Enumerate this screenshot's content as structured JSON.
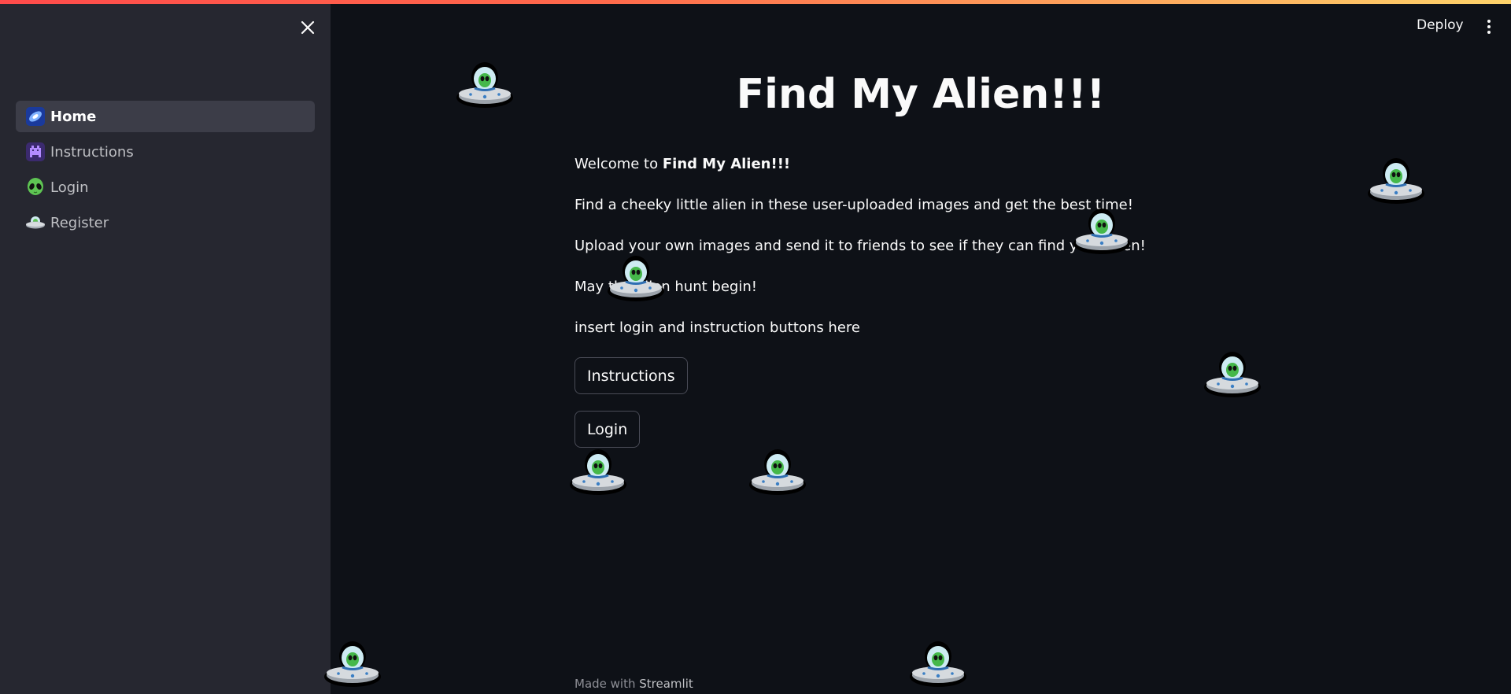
{
  "sidebar": {
    "close_label": "×",
    "items": [
      {
        "label": "Home",
        "icon": "galaxy-icon",
        "active": true
      },
      {
        "label": "Instructions",
        "icon": "space-invader-icon",
        "active": false
      },
      {
        "label": "Login",
        "icon": "alien-icon",
        "active": false
      },
      {
        "label": "Register",
        "icon": "ufo-icon",
        "active": false
      }
    ]
  },
  "header": {
    "deploy_label": "Deploy"
  },
  "main": {
    "title": "Find My Alien!!!",
    "welcome_prefix": "Welcome to ",
    "welcome_bold": "Find My Alien!!!",
    "line1": "Find a cheeky little alien in these user-uploaded images and get the best time!",
    "line2": "Upload your own images and send it to friends to see if they can find your alien!",
    "line3": "May the alien hunt begin!",
    "line4": "insert login and instruction buttons here",
    "instructions_button": "Instructions",
    "login_button": "Login"
  },
  "footer": {
    "prefix": "Made with ",
    "brand": "Streamlit"
  },
  "colors": {
    "background": "#0e1117",
    "sidebar": "#262730",
    "accent": "#ff4b4b",
    "text": "#fafafa"
  }
}
